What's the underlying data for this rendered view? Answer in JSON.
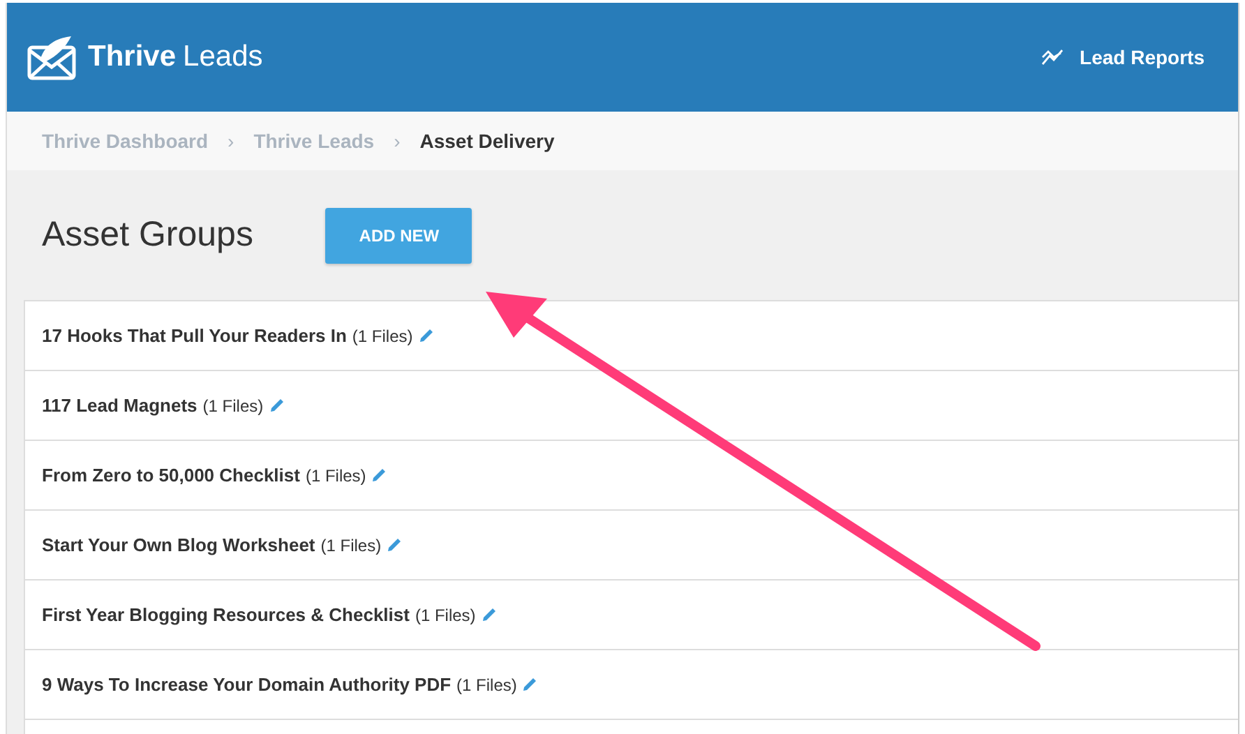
{
  "header": {
    "brand_bold": "Thrive",
    "brand_light": "Leads",
    "link": "Lead Reports"
  },
  "breadcrumb": [
    {
      "label": "Thrive Dashboard",
      "current": false
    },
    {
      "label": "Thrive Leads",
      "current": false
    },
    {
      "label": "Asset Delivery",
      "current": true
    }
  ],
  "breadcrumb_separator": "›",
  "page_title": "Asset Groups",
  "add_button": "ADD NEW",
  "asset_groups": [
    {
      "name": "17 Hooks That Pull Your Readers In",
      "count": "(1 Files)"
    },
    {
      "name": "117 Lead Magnets",
      "count": "(1 Files)"
    },
    {
      "name": "From Zero to 50,000 Checklist",
      "count": "(1 Files)"
    },
    {
      "name": "Start Your Own Blog Worksheet",
      "count": "(1 Files)"
    },
    {
      "name": "First Year Blogging Resources & Checklist",
      "count": "(1 Files)"
    },
    {
      "name": "9 Ways To Increase Your Domain Authority PDF",
      "count": "(1 Files)"
    }
  ]
}
